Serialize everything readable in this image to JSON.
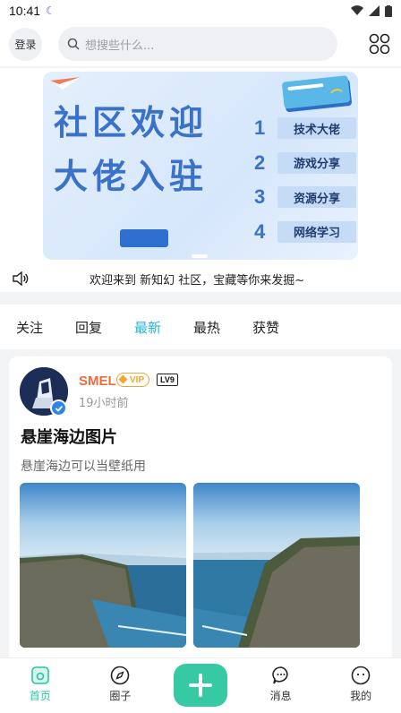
{
  "status": {
    "time": "10:41"
  },
  "header": {
    "login_label": "登录",
    "search_placeholder": "想搜些什么..."
  },
  "banner": {
    "line1": "社区欢迎",
    "line2": "大佬入驻",
    "items": [
      {
        "num": "1",
        "label": "技术大佬"
      },
      {
        "num": "2",
        "label": "游戏分享"
      },
      {
        "num": "3",
        "label": "资源分享"
      },
      {
        "num": "4",
        "label": "网络学习"
      }
    ]
  },
  "notice": {
    "text": "欢迎来到 新知幻 社区，宝藏等你来发掘~"
  },
  "tabs": [
    {
      "label": "关注"
    },
    {
      "label": "回复"
    },
    {
      "label": "最新"
    },
    {
      "label": "最热"
    },
    {
      "label": "获赞"
    }
  ],
  "post": {
    "username": "SMEL",
    "vip_label": "VIP",
    "level": "LV9",
    "time_ago": "19小时前",
    "title": "悬崖海边图片",
    "body": "悬崖海边可以当壁纸用"
  },
  "bottom_nav": [
    {
      "label": "首页"
    },
    {
      "label": "圈子"
    },
    {
      "label": "消息"
    },
    {
      "label": "我的"
    }
  ],
  "colors": {
    "accent": "#25b4d8",
    "nav_active": "#29c4a6",
    "plus_button": "#35c9a4"
  }
}
